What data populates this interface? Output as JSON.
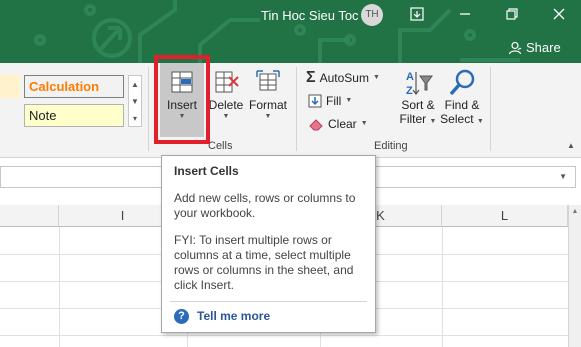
{
  "titlebar": {
    "title": "Tin Hoc Sieu Toc",
    "avatar_initials": "TH",
    "share_label": "Share",
    "accent_color": "#217346"
  },
  "ribbon": {
    "styles": {
      "calculation_label": "Calculation",
      "note_label": "Note"
    },
    "cells_group": {
      "label": "Cells",
      "insert_label": "Insert",
      "delete_label": "Delete",
      "format_label": "Format"
    },
    "editing_group": {
      "label": "Editing",
      "autosum_label": "AutoSum",
      "fill_label": "Fill",
      "clear_label": "Clear",
      "sort_filter_line1": "Sort &",
      "sort_filter_line2": "Filter",
      "find_select_line1": "Find &",
      "find_select_line2": "Select"
    },
    "highlight_color": "#e0202a"
  },
  "grid": {
    "columns": [
      "I",
      "K",
      "L"
    ]
  },
  "tooltip": {
    "title": "Insert Cells",
    "description": "Add new cells, rows or columns to your workbook.",
    "fyi": "FYI: To insert multiple rows or columns at a time, select multiple rows or columns in the sheet, and click Insert.",
    "tell_me_more": "Tell me more"
  }
}
